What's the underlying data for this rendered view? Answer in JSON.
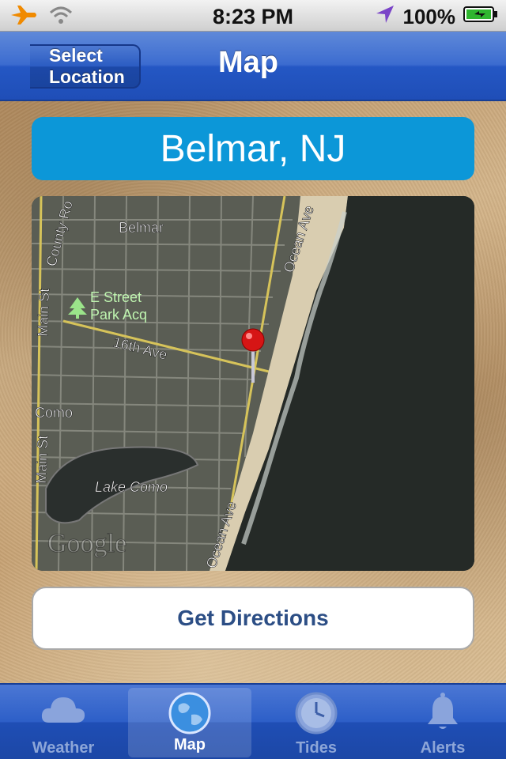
{
  "status_bar": {
    "time": "8:23 PM",
    "battery": "100%",
    "icons": [
      "airplane-icon",
      "wifi-icon",
      "location-arrow-icon",
      "battery-charging-icon"
    ]
  },
  "nav_bar": {
    "back_label": "Select Location",
    "title": "Map"
  },
  "location": {
    "name": "Belmar, NJ"
  },
  "map": {
    "labels": {
      "belmar": "Belmar",
      "county_rd": "County Ro",
      "ocean_ave_top": "Ocean Ave",
      "main_st_top": "Main St",
      "park": "E Street",
      "park2": "Park Acq",
      "avenue": "16th Ave",
      "como": "Como",
      "main_st_bottom": "Main St",
      "lake": "Lake Como",
      "ocean_ave_bottom": "Ocean Ave",
      "google": "Google"
    },
    "colors": {
      "ocean": "#252a27",
      "beach": "#d9cdb0",
      "land": "#5a5d54"
    }
  },
  "actions": {
    "directions_label": "Get Directions"
  },
  "tab_bar": {
    "tabs": [
      {
        "label": "Weather",
        "icon": "cloud-icon",
        "active": false
      },
      {
        "label": "Map",
        "icon": "globe-icon",
        "active": true
      },
      {
        "label": "Tides",
        "icon": "clock-icon",
        "active": false
      },
      {
        "label": "Alerts",
        "icon": "bell-icon",
        "active": false
      }
    ]
  },
  "colors": {
    "accent_blue": "#0c97d8",
    "nav_blue": "#2457c4",
    "button_text": "#2c4e85"
  }
}
